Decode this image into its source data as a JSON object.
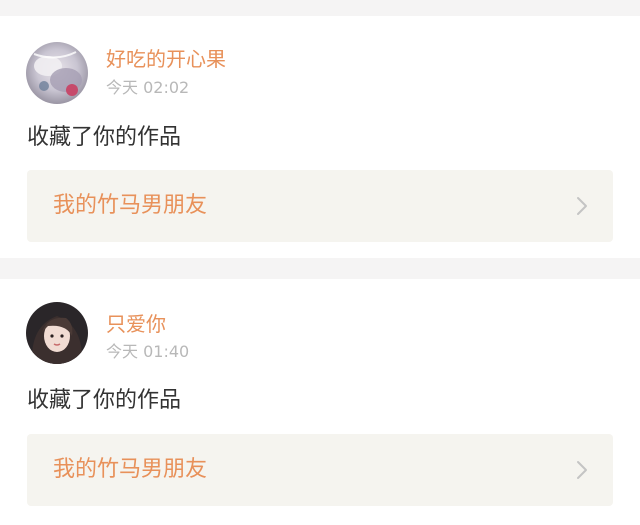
{
  "notifications": [
    {
      "username": "好吃的开心果",
      "time": "今天 02:02",
      "action": "收藏了你的作品",
      "work_title": "我的竹马男朋友"
    },
    {
      "username": "只爱你",
      "time": "今天 01:40",
      "action": "收藏了你的作品",
      "work_title": "我的竹马男朋友"
    }
  ],
  "colors": {
    "username": "#e8915a",
    "timestamp": "#b8b8b8",
    "action_text": "#333333",
    "link_background": "#f5f4ef",
    "page_background": "#f5f4f4"
  },
  "icons": {
    "link_arrow": "chevron-right-icon"
  }
}
